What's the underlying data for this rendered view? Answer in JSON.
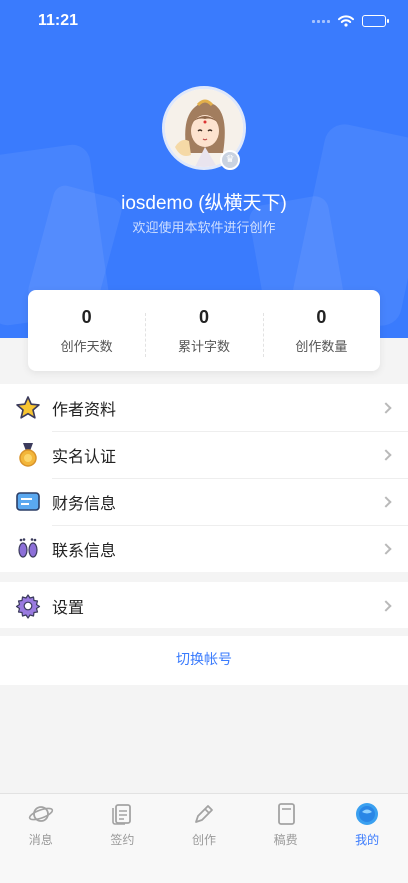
{
  "status_bar": {
    "time": "11:21"
  },
  "profile": {
    "username": "iosdemo (纵横天下)",
    "subtitle": "欢迎使用本软件进行创作"
  },
  "stats": [
    {
      "value": "0",
      "label": "创作天数"
    },
    {
      "value": "0",
      "label": "累计字数"
    },
    {
      "value": "0",
      "label": "创作数量"
    }
  ],
  "menu": [
    {
      "label": "作者资料",
      "icon": "star-icon"
    },
    {
      "label": "实名认证",
      "icon": "medal-icon"
    },
    {
      "label": "财务信息",
      "icon": "finance-card-icon"
    },
    {
      "label": "联系信息",
      "icon": "footprints-icon"
    }
  ],
  "settings": {
    "label": "设置",
    "icon": "gear-icon"
  },
  "switch_account": "切换帐号",
  "tabs": [
    {
      "label": "消息",
      "icon": "planet-icon"
    },
    {
      "label": "签约",
      "icon": "contract-icon"
    },
    {
      "label": "创作",
      "icon": "pen-icon"
    },
    {
      "label": "稿费",
      "icon": "book-icon"
    },
    {
      "label": "我的",
      "icon": "profile-circle-icon",
      "active": true
    }
  ],
  "colors": {
    "primary": "#3a7bfd",
    "background": "#f4f4f4"
  }
}
